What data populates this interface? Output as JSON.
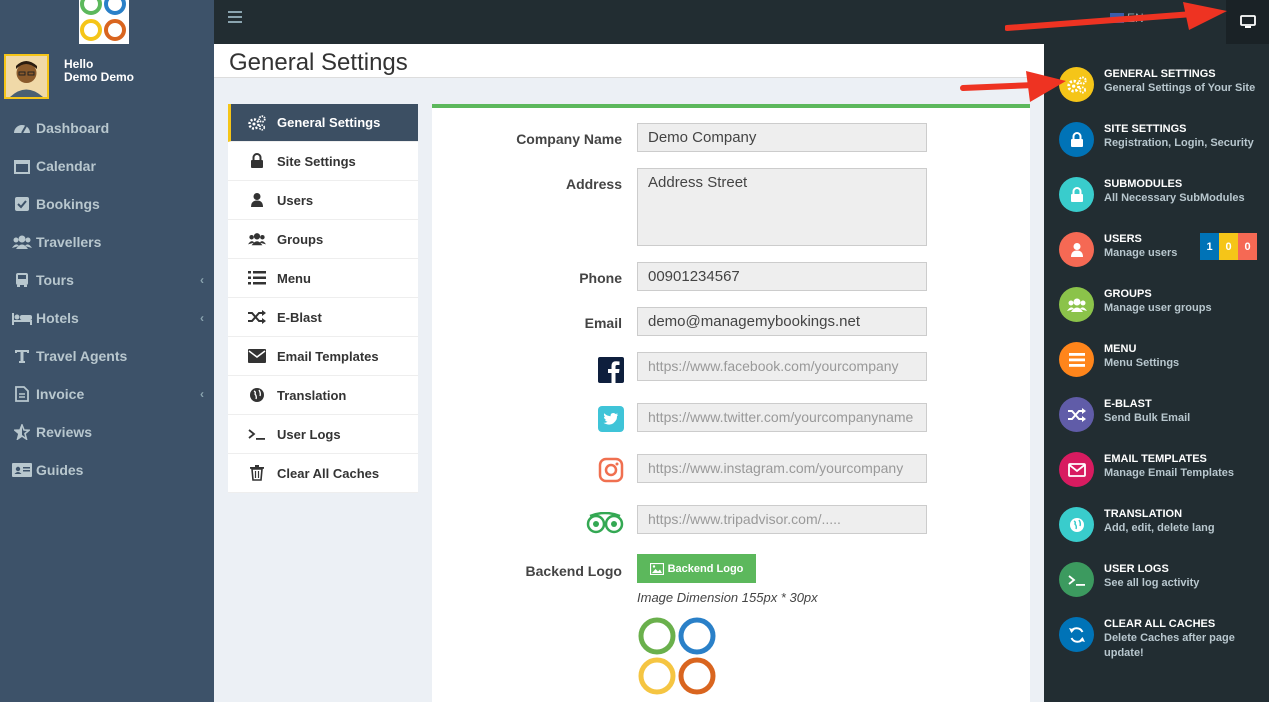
{
  "sidebar": {
    "user": {
      "hello": "Hello",
      "name": "Demo Demo"
    },
    "items": [
      {
        "label": "Dashboard",
        "icon": "dashboard-icon"
      },
      {
        "label": "Calendar",
        "icon": "calendar-icon"
      },
      {
        "label": "Bookings",
        "icon": "check-square-icon"
      },
      {
        "label": "Travellers",
        "icon": "users-icon"
      },
      {
        "label": "Tours",
        "icon": "bus-icon",
        "chevron": "‹"
      },
      {
        "label": "Hotels",
        "icon": "bed-icon",
        "chevron": "‹"
      },
      {
        "label": "Travel Agents",
        "icon": "text-icon"
      },
      {
        "label": "Invoice",
        "icon": "file-icon",
        "chevron": "‹"
      },
      {
        "label": "Reviews",
        "icon": "star-icon"
      },
      {
        "label": "Guides",
        "icon": "id-card-icon"
      }
    ]
  },
  "topbar": {
    "lang": "EN"
  },
  "page": {
    "title": "General Settings"
  },
  "settings_menu": [
    {
      "label": "General Settings",
      "icon": "cogs-icon",
      "active": true
    },
    {
      "label": "Site Settings",
      "icon": "lock-icon"
    },
    {
      "label": "Users",
      "icon": "user-icon"
    },
    {
      "label": "Groups",
      "icon": "users-icon"
    },
    {
      "label": "Menu",
      "icon": "list-icon"
    },
    {
      "label": "E-Blast",
      "icon": "shuffle-icon"
    },
    {
      "label": "Email Templates",
      "icon": "envelope-icon"
    },
    {
      "label": "Translation",
      "icon": "globe-icon"
    },
    {
      "label": "User Logs",
      "icon": "terminal-icon"
    },
    {
      "label": "Clear All Caches",
      "icon": "trash-icon"
    }
  ],
  "form": {
    "company_label": "Company Name",
    "company_value": "Demo Company",
    "address_label": "Address",
    "address_value": "Address Street",
    "phone_label": "Phone",
    "phone_value": "00901234567",
    "email_label": "Email",
    "email_value": "demo@managemybookings.net",
    "facebook_placeholder": "https://www.facebook.com/yourcompany",
    "twitter_placeholder": "https://www.twitter.com/yourcompanyname",
    "instagram_placeholder": "https://www.instagram.com/yourcompany",
    "tripadvisor_placeholder": "https://www.tripadvisor.com/.....",
    "backend_logo_label": "Backend Logo",
    "backend_logo_button": "Backend Logo",
    "image_dimension": "Image Dimension 155px * 30px"
  },
  "right_panel": [
    {
      "title": "GENERAL SETTINGS",
      "sub": "General Settings of Your Site",
      "color": "#f5c518",
      "icon": "cogs-icon"
    },
    {
      "title": "SITE SETTINGS",
      "sub": "Registration, Login, Security",
      "color": "#0073b7",
      "icon": "lock-icon"
    },
    {
      "title": "SUBMODULES",
      "sub": "All Necessary SubModules",
      "color": "#39cccc",
      "icon": "lock-icon"
    },
    {
      "title": "USERS",
      "sub": "Manage users",
      "color": "#f56954",
      "icon": "user-icon"
    },
    {
      "title": "GROUPS",
      "sub": "Manage user groups",
      "color": "#8bc34a",
      "icon": "users-icon"
    },
    {
      "title": "MENU",
      "sub": "Menu Settings",
      "color": "#ff851b",
      "icon": "list-icon"
    },
    {
      "title": "E-BLAST",
      "sub": "Send Bulk Email",
      "color": "#605ca8",
      "icon": "shuffle-icon"
    },
    {
      "title": "EMAIL TEMPLATES",
      "sub": "Manage Email Templates",
      "color": "#d81b60",
      "icon": "envelope-icon"
    },
    {
      "title": "TRANSLATION",
      "sub": "Add, edit, delete lang",
      "color": "#39cccc",
      "icon": "globe-icon"
    },
    {
      "title": "USER LOGS",
      "sub": "See all log activity",
      "color": "#3c9a5f",
      "icon": "terminal-icon"
    },
    {
      "title": "CLEAR ALL CACHES",
      "sub": "Delete Caches after page update!",
      "color": "#0073b7",
      "icon": "refresh-icon"
    }
  ],
  "user_badges": [
    {
      "value": "1",
      "color": "#0073b7"
    },
    {
      "value": "0",
      "color": "#f5c518"
    },
    {
      "value": "0",
      "color": "#f56954"
    }
  ]
}
